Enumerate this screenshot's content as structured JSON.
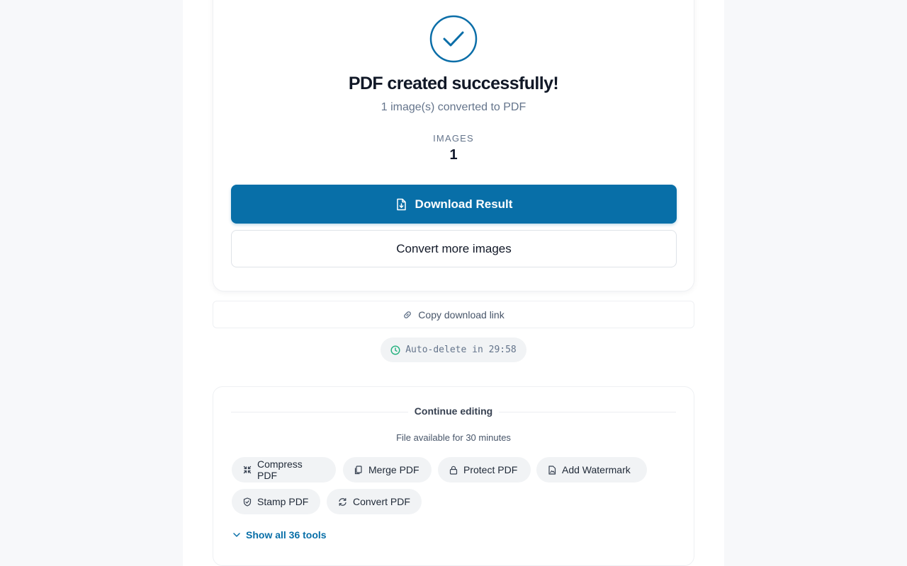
{
  "result": {
    "title": "PDF created successfully!",
    "subtitle": "1 image(s) converted to PDF",
    "stat_label": "IMAGES",
    "stat_value": "1"
  },
  "actions": {
    "download_label": "Download Result",
    "convert_more_label": "Convert more images",
    "copy_link_label": "Copy download link",
    "auto_delete_text": "Auto-delete in 29:58"
  },
  "continue_editing": {
    "title": "Continue editing",
    "note": "File available for 30 minutes",
    "tools": [
      {
        "label": "Compress PDF",
        "icon": "compress-icon"
      },
      {
        "label": "Merge PDF",
        "icon": "merge-icon"
      },
      {
        "label": "Protect PDF",
        "icon": "lock-icon"
      },
      {
        "label": "Add Watermark",
        "icon": "watermark-icon"
      },
      {
        "label": "Stamp PDF",
        "icon": "stamp-icon"
      },
      {
        "label": "Convert PDF",
        "icon": "refresh-icon"
      }
    ],
    "show_all_label": "Show all 36 tools"
  },
  "colors": {
    "accent": "#086fa8",
    "success_ring": "#0b6ea8",
    "timer_icon": "#22b07d",
    "background": "#f7f8fa"
  }
}
